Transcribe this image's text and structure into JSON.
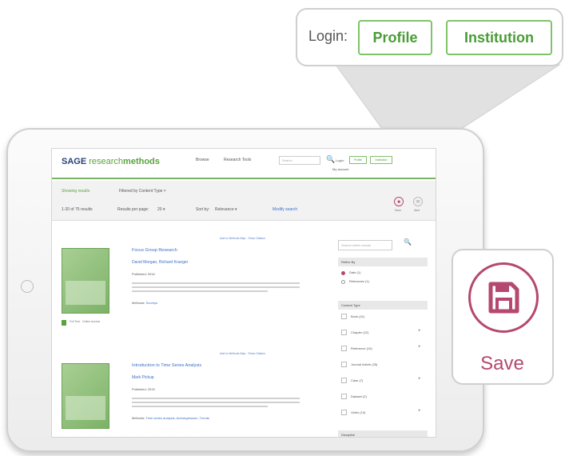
{
  "colors": {
    "green": "#5aa33b",
    "navy": "#28407a",
    "magenta": "#b5486f",
    "link": "#3b6fc4"
  },
  "header": {
    "logo_sage": "SAGE",
    "logo_research": "research",
    "logo_methods": "methods",
    "nav": [
      "Browse",
      "Research Tools"
    ],
    "search_placeholder": "Search",
    "search_icon": "search-icon",
    "login_label": "Login:",
    "login_profile": "Profile",
    "login_institution": "Institution",
    "account": "My account"
  },
  "toolbar": {
    "showing": "Showing results",
    "filtered": "Filtered by Content Type",
    "count": "1-20 of 75 results",
    "per_page_label": "Results per page:",
    "per_page_value": "20",
    "sort_label": "Sort by:",
    "sort_value": "Relevance",
    "modify": "Modify search",
    "save_label": "Save",
    "email_label": "Alert",
    "save_icon": "floppy-disk-icon",
    "email_icon": "bell-icon"
  },
  "results": [
    {
      "add_link": "Add to Methods Map · Show Citation",
      "title": "Focus Group Research",
      "author": "David Morgan, Richard Krueger",
      "published_label": "Published: 2016",
      "body_lines": 3,
      "methods_label": "Methods:",
      "methods_value": "Surveys",
      "badge": "Full Text · Online Access"
    },
    {
      "add_link": "Add to Methods Map · Show Citation",
      "title": "Introduction to Time Series Analysis",
      "author": "Mark Pickup",
      "published_label": "Published: 2015",
      "body_lines": 3,
      "methods_label": "Methods:",
      "methods_value": "Time series analysis, Autoregression, Trends"
    }
  ],
  "sidebar": {
    "search_placeholder": "Search within results",
    "search_icon": "search-icon",
    "sort_head": "Refine By",
    "sort_options": [
      {
        "label": "Date (1)",
        "selected": true
      },
      {
        "label": "Relevance (1)",
        "selected": false
      }
    ],
    "content_head": "Content Type",
    "content_items": [
      {
        "label": "Book (41)",
        "expandable": false
      },
      {
        "label": "Chapter (22)",
        "expandable": true
      },
      {
        "label": "Reference (19)",
        "expandable": true
      },
      {
        "label": "Journal Article (25)",
        "expandable": false
      },
      {
        "label": "Case (7)",
        "expandable": true
      },
      {
        "label": "Dataset (2)",
        "expandable": false
      },
      {
        "label": "Video (10)",
        "expandable": true
      }
    ],
    "discipline_head": "Discipline"
  },
  "zoom": {
    "login_label": "Login:",
    "profile": "Profile",
    "institution": "Institution",
    "save": "Save",
    "save_icon": "floppy-disk-icon"
  }
}
